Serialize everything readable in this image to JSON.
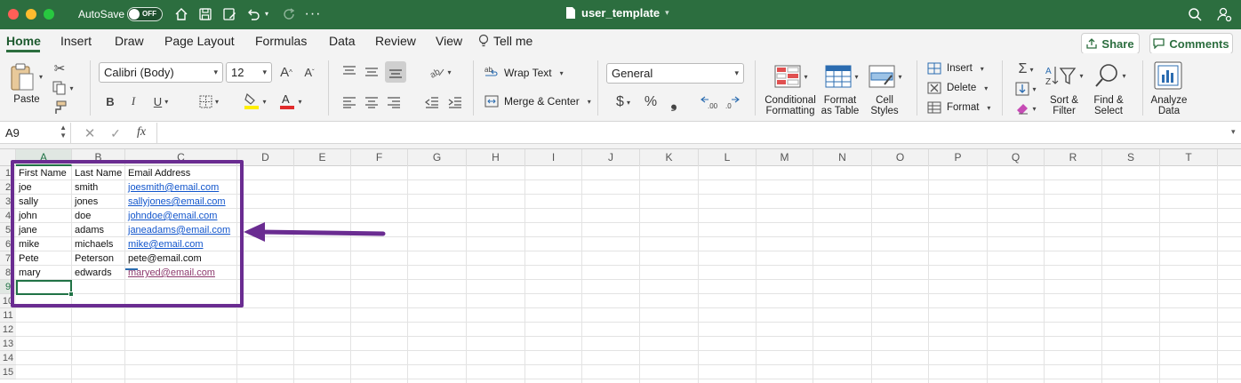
{
  "window": {
    "title": "user_template",
    "autosave_label": "AutoSave",
    "autosave_state": "OFF"
  },
  "tabs": [
    "Home",
    "Insert",
    "Draw",
    "Page Layout",
    "Formulas",
    "Data",
    "Review",
    "View"
  ],
  "tell_me": "Tell me",
  "share_label": "Share",
  "comments_label": "Comments",
  "ribbon": {
    "paste": "Paste",
    "font_name": "Calibri (Body)",
    "font_size": "12",
    "wrap_text": "Wrap Text",
    "merge_center": "Merge & Center",
    "number_format": "General",
    "conditional_formatting": [
      "Conditional",
      "Formatting"
    ],
    "format_as_table": [
      "Format",
      "as Table"
    ],
    "cell_styles": [
      "Cell",
      "Styles"
    ],
    "insert": "Insert",
    "delete": "Delete",
    "format": "Format",
    "sort_filter": [
      "Sort &",
      "Filter"
    ],
    "find_select": [
      "Find &",
      "Select"
    ],
    "analyze_data": [
      "Analyze",
      "Data"
    ]
  },
  "formula_bar": {
    "name_box": "A9",
    "fx": "fx",
    "value": ""
  },
  "columns": [
    "A",
    "B",
    "C",
    "D",
    "E",
    "F",
    "G",
    "H",
    "I",
    "J",
    "K",
    "L",
    "M",
    "N",
    "O",
    "P",
    "Q",
    "R",
    "S",
    "T"
  ],
  "rows": [
    "1",
    "2",
    "3",
    "4",
    "5",
    "6",
    "7",
    "8",
    "9",
    "10",
    "11",
    "12",
    "13",
    "14",
    "15"
  ],
  "sheet": [
    [
      "First Name",
      "Last Name",
      "Email Address"
    ],
    [
      "joe",
      "smith",
      "joesmith@email.com"
    ],
    [
      "sally",
      "jones",
      "sallyjones@email.com"
    ],
    [
      "john",
      "doe",
      "johndoe@email.com"
    ],
    [
      "jane",
      "adams",
      "janeadams@email.com"
    ],
    [
      "mike",
      "michaels",
      "mike@email.com"
    ],
    [
      "Pete",
      "Peterson",
      "pete@email.com"
    ],
    [
      "mary",
      "edwards",
      "maryed@email.com"
    ]
  ],
  "email_styles": [
    "header",
    "link",
    "link",
    "link",
    "link",
    "link",
    "plain",
    "visited"
  ],
  "colors": {
    "title_bar": "#2c6e3f",
    "annotation": "#6a2c91",
    "link": "#1155cc",
    "visited_link": "#8d3a6e"
  }
}
